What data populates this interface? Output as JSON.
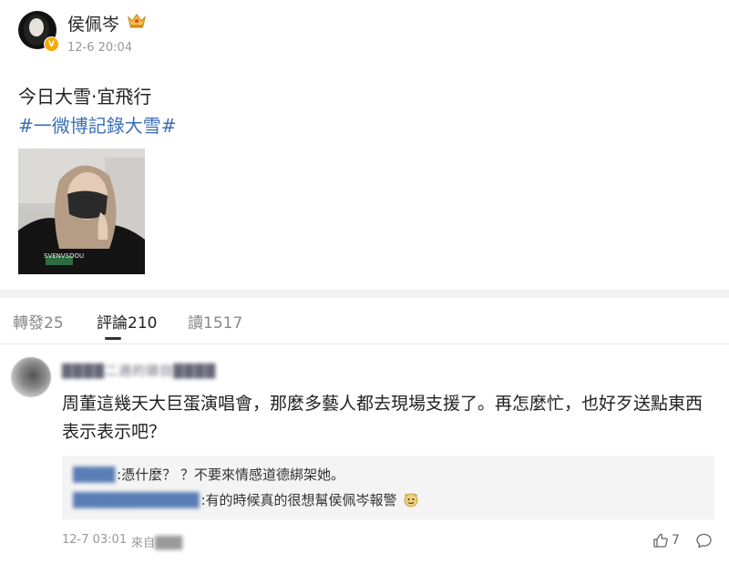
{
  "post": {
    "username": "侯佩岑",
    "verified_badge": "V",
    "time": "12-6 20:04",
    "text": "今日大雪·宜飛行",
    "hashtag": "#一微博記錄大雪#",
    "photo_shirt_text": "SVENVSDOU"
  },
  "tabs": {
    "reposts": "轉發25",
    "comments": "評論210",
    "reads": "讀1517"
  },
  "comment": {
    "username": "████二週的頭目████",
    "text": "周董這幾天大巨蛋演唱會，那麼多藝人都去現場支援了。再怎麼忙，也好歹送點東西表示表示吧？",
    "replies": [
      {
        "name": "████",
        "text": ":憑什麼？ ？不要來情感道德綁架她。"
      },
      {
        "name": "████████████",
        "text": ":有的時候真的很想幫侯佩岑報警"
      }
    ],
    "time": "12-7 03:01",
    "source_prefix": "來自",
    "source_name": "███",
    "likes": "7"
  },
  "colors": {
    "hashtag": "#3b6fb6",
    "badge": "#f7a800",
    "muted": "#999999"
  },
  "icons": [
    "crown-icon",
    "verified-badge-icon",
    "like-icon",
    "comment-icon",
    "emoji-icon"
  ]
}
